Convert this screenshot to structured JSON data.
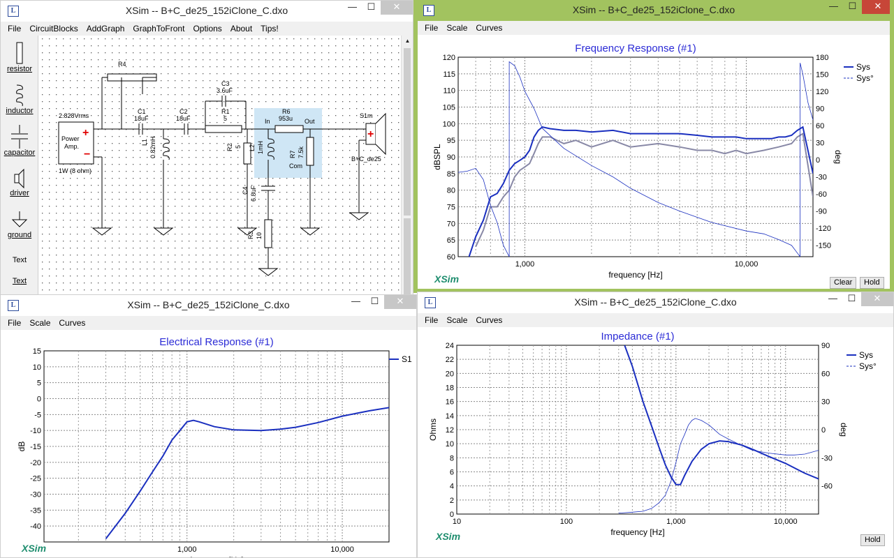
{
  "windows": {
    "circuit": {
      "title": "XSim -- B+C_de25_152iClone_C.dxo",
      "menu": [
        "File",
        "CircuitBlocks",
        "AddGraph",
        "GraphToFront",
        "Options",
        "About",
        "Tips!"
      ],
      "toolbox": [
        "resistor",
        "inductor",
        "capacitor",
        "driver",
        "ground",
        "Text",
        "Text"
      ],
      "parts": {
        "r4": "R4",
        "c1": "C1",
        "c1v": "18uF",
        "c2": "C2",
        "c2v": "18uF",
        "c3": "C3",
        "c3v": "3.6uF",
        "r1": "R1",
        "r1v": "5",
        "l1": "L1",
        "l1v": "0.82mH",
        "r2": "R2",
        "r2v": "5",
        "l2": "L2",
        "l2v": "1mH",
        "r6": "R6",
        "r6v": "953u",
        "r7": "R7",
        "r7v": "7.5k",
        "c4": "C4",
        "c4v": "6.8uF",
        "r3": "R3",
        "r3v": "10",
        "in": "In",
        "out": "Out",
        "com": "Com",
        "s1m": "S1m",
        "driver": "B+C_de25",
        "src_v": "2.828Vrms",
        "src_l1": "Power",
        "src_l2": "Amp.",
        "src_load": "1W (8 ohm)"
      }
    },
    "freq": {
      "title": "XSim -- B+C_de25_152iClone_C.dxo",
      "menu": [
        "File",
        "Scale",
        "Curves"
      ],
      "buttons": {
        "clear": "Clear",
        "hold": "Hold"
      },
      "logo": "XSim"
    },
    "elec": {
      "title": "XSim -- B+C_de25_152iClone_C.dxo",
      "menu": [
        "File",
        "Scale",
        "Curves"
      ],
      "logo": "XSim"
    },
    "imp": {
      "title": "XSim -- B+C_de25_152iClone_C.dxo",
      "menu": [
        "File",
        "Scale",
        "Curves"
      ],
      "buttons": {
        "hold": "Hold"
      },
      "logo": "XSim"
    }
  },
  "colors": {
    "active_frame": "#a2c35f",
    "curve": "#1a2fbf",
    "curve_gray": "#8888a6",
    "title": "#2b2bd6",
    "logo": "#1e8d6e"
  },
  "chart_data": [
    {
      "type": "line",
      "title": "Frequency Response (#1)",
      "xlabel": "frequency [Hz]",
      "ylabel": "dBSPL",
      "y2label": "deg",
      "xscale": "log",
      "xlim": [
        500,
        20000
      ],
      "ylim": [
        60,
        120
      ],
      "y2lim": [
        -170,
        180
      ],
      "yticks": [
        "60",
        "65",
        "70",
        "75",
        "80",
        "85",
        "90",
        "95",
        "100",
        "105",
        "110",
        "115",
        "120"
      ],
      "y2ticks": [
        "-150",
        "-120",
        "-90",
        "-60",
        "-30",
        "0",
        "30",
        "60",
        "90",
        "120",
        "150",
        "180"
      ],
      "xticks": [
        "1,000",
        "10,000"
      ],
      "legend": [
        "Sys",
        "Sys°"
      ],
      "legend_placement": "top-right",
      "series": [
        {
          "name": "Sys",
          "x": [
            560,
            600,
            650,
            700,
            750,
            800,
            850,
            900,
            950,
            1000,
            1050,
            1100,
            1150,
            1200,
            1300,
            1500,
            1700,
            2000,
            2500,
            3000,
            4000,
            5000,
            6000,
            7000,
            8000,
            9000,
            10000,
            11000,
            12000,
            13000,
            14000,
            15000,
            16000,
            17000,
            18000,
            20000
          ],
          "y": [
            60,
            66,
            71,
            78,
            79,
            82,
            86,
            88,
            89,
            90,
            92,
            96,
            98,
            99,
            98.5,
            98,
            98,
            97.5,
            98,
            97,
            97,
            97,
            96.5,
            96,
            96,
            96,
            95.5,
            95.5,
            95.5,
            95.5,
            96,
            96,
            96.5,
            98,
            99,
            85
          ]
        },
        {
          "name": "Sys (gray)",
          "x": [
            600,
            650,
            700,
            750,
            800,
            850,
            900,
            950,
            1000,
            1050,
            1100,
            1150,
            1200,
            1300,
            1500,
            1700,
            2000,
            2500,
            3000,
            4000,
            5000,
            6000,
            7000,
            8000,
            9000,
            10000,
            12000,
            14000,
            16000,
            17000,
            18000,
            20000
          ],
          "y": [
            63,
            68,
            75,
            75,
            78,
            80,
            84,
            86,
            87,
            88,
            91,
            94,
            96,
            96,
            94,
            95,
            93,
            95,
            93,
            94,
            93,
            92,
            92,
            91,
            92,
            91,
            92,
            93,
            94,
            96,
            97,
            78
          ]
        },
        {
          "name": "Sys°",
          "x": [
            500,
            550,
            600,
            650,
            700,
            750,
            800,
            850,
            850,
            900,
            950,
            1000,
            1100,
            1200,
            1500,
            2000,
            2500,
            3000,
            4000,
            5000,
            7000,
            10000,
            12000,
            14000,
            16000,
            17500,
            17500,
            18000,
            19000,
            20000
          ],
          "y": [
            -22,
            -20,
            -15,
            -35,
            -80,
            -110,
            -150,
            -170,
            172,
            165,
            145,
            120,
            90,
            55,
            20,
            -10,
            -30,
            -50,
            -75,
            -90,
            -110,
            -125,
            -130,
            -140,
            -150,
            -170,
            170,
            150,
            100,
            70
          ]
        }
      ]
    },
    {
      "type": "line",
      "title": "Electrical Response (#1)",
      "xlabel": "frequency [Hz]",
      "ylabel": "dB",
      "xscale": "log",
      "xlim": [
        120,
        20000
      ],
      "ylim": [
        -45,
        15
      ],
      "yticks": [
        "-40",
        "-35",
        "-30",
        "-25",
        "-20",
        "-15",
        "-10",
        "-5",
        "0",
        "5",
        "10",
        "15"
      ],
      "xticks": [
        "1,000",
        "10,000"
      ],
      "legend": [
        "S1"
      ],
      "legend_placement": "right",
      "series": [
        {
          "name": "S1",
          "x": [
            300,
            400,
            500,
            600,
            700,
            800,
            900,
            1000,
            1100,
            1200,
            1500,
            2000,
            3000,
            4000,
            5000,
            7000,
            10000,
            15000,
            20000
          ],
          "y": [
            -44,
            -36,
            -29,
            -23,
            -18,
            -13,
            -10,
            -7.3,
            -6.8,
            -7.3,
            -8.8,
            -9.8,
            -10,
            -9.6,
            -9,
            -7.5,
            -5.5,
            -3.8,
            -2.8
          ]
        }
      ]
    },
    {
      "type": "line",
      "title": "Impedance (#1)",
      "xlabel": "frequency [Hz]",
      "ylabel": "Ohms",
      "y2label": "deg",
      "xscale": "log",
      "xlim": [
        10,
        20000
      ],
      "ylim": [
        0,
        24
      ],
      "y2lim": [
        -90,
        90
      ],
      "yticks": [
        "0",
        "2",
        "4",
        "6",
        "8",
        "10",
        "12",
        "14",
        "16",
        "18",
        "20",
        "22",
        "24"
      ],
      "y2ticks": [
        "-60",
        "-30",
        "0",
        "30",
        "60",
        "90"
      ],
      "xticks": [
        "10",
        "100",
        "1,000",
        "10,000"
      ],
      "legend": [
        "Sys",
        "Sys°"
      ],
      "legend_placement": "top-right",
      "series": [
        {
          "name": "Sys",
          "x": [
            340,
            400,
            500,
            600,
            700,
            800,
            900,
            1000,
            1100,
            1200,
            1400,
            1700,
            2000,
            2500,
            3000,
            4000,
            5000,
            7000,
            10000,
            15000,
            20000
          ],
          "y": [
            24,
            21,
            16,
            12.5,
            9.5,
            7,
            5.3,
            4.2,
            4.2,
            5.5,
            7.5,
            9.2,
            10,
            10.4,
            10.3,
            9.8,
            9.2,
            8.2,
            7.2,
            5.8,
            5
          ]
        },
        {
          "name": "Sys°",
          "x": [
            300,
            400,
            500,
            600,
            700,
            800,
            900,
            1000,
            1100,
            1200,
            1300,
            1400,
            1500,
            1700,
            2000,
            2500,
            3000,
            4000,
            5000,
            7000,
            10000,
            12000,
            15000,
            20000
          ],
          "y": [
            -89,
            -88,
            -87,
            -84,
            -78,
            -70,
            -55,
            -35,
            -15,
            -5,
            5,
            10,
            12,
            10,
            5,
            -5,
            -10,
            -17,
            -22,
            -25,
            -27,
            -27,
            -26,
            -22
          ]
        }
      ]
    }
  ]
}
